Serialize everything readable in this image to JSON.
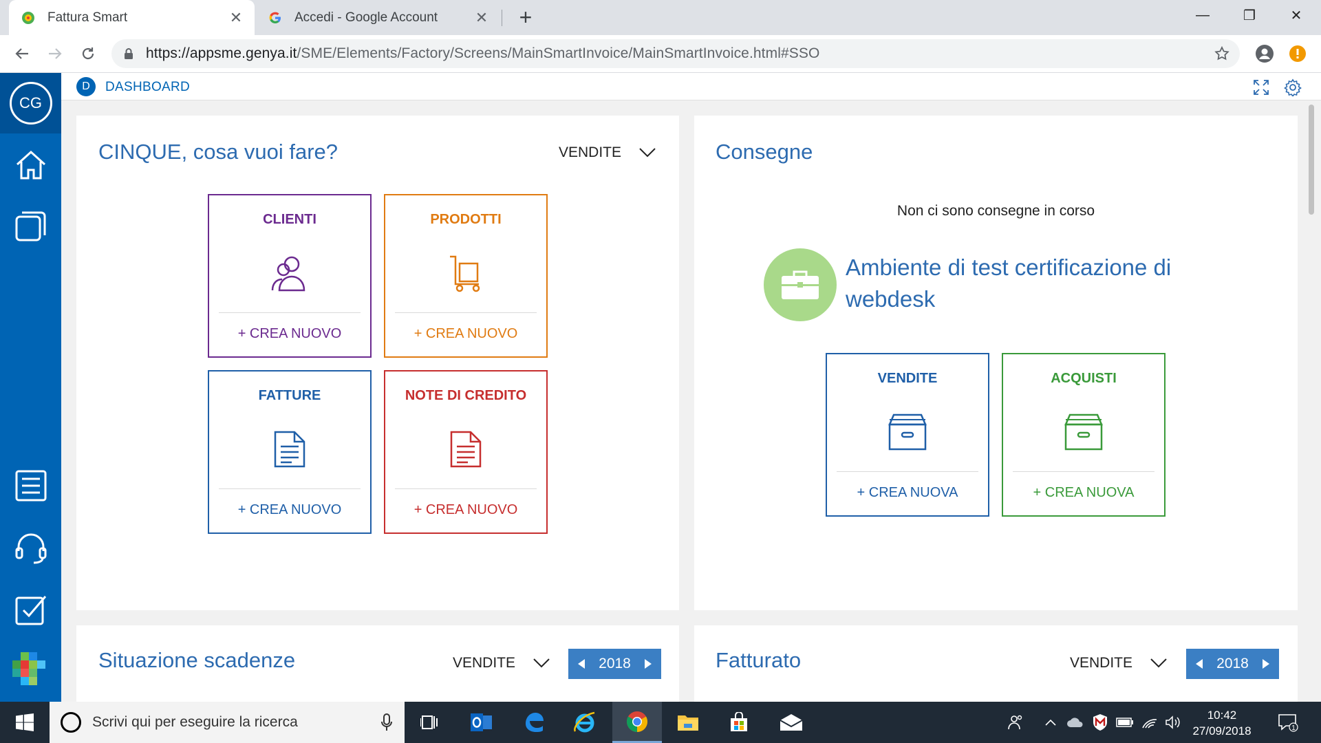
{
  "browser": {
    "tabs": [
      {
        "title": "Fattura Smart",
        "active": true
      },
      {
        "title": "Accedi - Google Account",
        "active": false
      }
    ],
    "close_glyph": "✕",
    "new_tab_glyph": "+",
    "url_host": "https://appsme.genya.it",
    "url_path": "/SME/Elements/Factory/Screens/MainSmartInvoice/MainSmartInvoice.html#SSO",
    "window_controls": {
      "minimize": "—",
      "restore": "❐",
      "close": "✕"
    }
  },
  "sidebar": {
    "user_initials": "CG",
    "items": [
      {
        "icon": "home-icon"
      },
      {
        "icon": "pages-icon"
      },
      {
        "icon": "list-icon"
      },
      {
        "icon": "headset-icon"
      },
      {
        "icon": "checkbox-icon"
      }
    ]
  },
  "header": {
    "badge": "D",
    "title": "DASHBOARD"
  },
  "actions_card": {
    "title": "CINQUE, cosa vuoi fare?",
    "dropdown_value": "VENDITE",
    "tiles": [
      {
        "label": "CLIENTI",
        "action": "+ CREA NUOVO",
        "icon": "users-icon",
        "color": "#6b2a8f"
      },
      {
        "label": "PRODOTTI",
        "action": "+ CREA NUOVO",
        "icon": "cart-icon",
        "color": "#e07b12"
      },
      {
        "label": "FATTURE",
        "action": "+ CREA NUOVO",
        "icon": "document-icon",
        "color": "#1f5fa8"
      },
      {
        "label": "NOTE DI CREDITO",
        "action": "+ CREA NUOVO",
        "icon": "document-icon",
        "color": "#c62e2e"
      }
    ]
  },
  "deliveries_card": {
    "title": "Consegne",
    "empty_message": "Non ci sono consegne in corso",
    "environment_line1": "Ambiente di test certificazione di",
    "environment_line2": "webdesk",
    "tiles": [
      {
        "label": "VENDITE",
        "action": "+ CREA NUOVA",
        "icon": "archive-icon",
        "color": "#1f5fa8"
      },
      {
        "label": "ACQUISTI",
        "action": "+ CREA NUOVA",
        "icon": "archive-icon",
        "color": "#3a9a3a"
      }
    ]
  },
  "deadlines_card": {
    "title": "Situazione scadenze",
    "dropdown_value": "VENDITE",
    "year": "2018"
  },
  "revenue_card": {
    "title": "Fatturato",
    "dropdown_value": "VENDITE",
    "year": "2018"
  },
  "taskbar": {
    "search_placeholder": "Scrivi qui per eseguire la ricerca",
    "time": "10:42",
    "date": "27/09/2018",
    "notification_count": "1"
  },
  "colors": {
    "brand_blue": "#0064b4",
    "title_blue": "#2d6bb0",
    "env_green": "#a9d98a"
  }
}
